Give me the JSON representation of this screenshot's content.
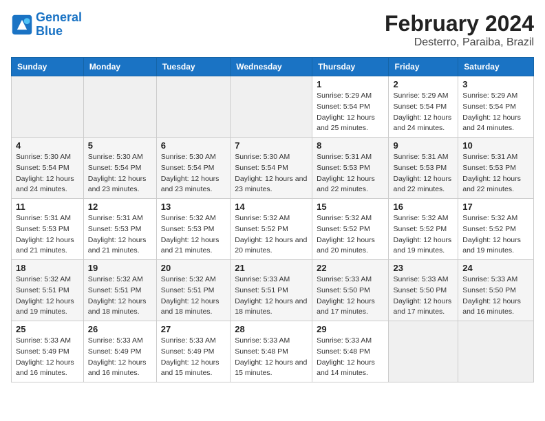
{
  "logo": {
    "line1": "General",
    "line2": "Blue"
  },
  "title": "February 2024",
  "subtitle": "Desterro, Paraiba, Brazil",
  "days_of_week": [
    "Sunday",
    "Monday",
    "Tuesday",
    "Wednesday",
    "Thursday",
    "Friday",
    "Saturday"
  ],
  "weeks": [
    [
      {
        "day": "",
        "sunrise": "",
        "sunset": "",
        "daylight": "",
        "empty": true
      },
      {
        "day": "",
        "sunrise": "",
        "sunset": "",
        "daylight": "",
        "empty": true
      },
      {
        "day": "",
        "sunrise": "",
        "sunset": "",
        "daylight": "",
        "empty": true
      },
      {
        "day": "",
        "sunrise": "",
        "sunset": "",
        "daylight": "",
        "empty": true
      },
      {
        "day": "1",
        "sunrise": "5:29 AM",
        "sunset": "5:54 PM",
        "daylight": "12 hours and 25 minutes.",
        "empty": false
      },
      {
        "day": "2",
        "sunrise": "5:29 AM",
        "sunset": "5:54 PM",
        "daylight": "12 hours and 24 minutes.",
        "empty": false
      },
      {
        "day": "3",
        "sunrise": "5:29 AM",
        "sunset": "5:54 PM",
        "daylight": "12 hours and 24 minutes.",
        "empty": false
      }
    ],
    [
      {
        "day": "4",
        "sunrise": "5:30 AM",
        "sunset": "5:54 PM",
        "daylight": "12 hours and 24 minutes.",
        "empty": false
      },
      {
        "day": "5",
        "sunrise": "5:30 AM",
        "sunset": "5:54 PM",
        "daylight": "12 hours and 23 minutes.",
        "empty": false
      },
      {
        "day": "6",
        "sunrise": "5:30 AM",
        "sunset": "5:54 PM",
        "daylight": "12 hours and 23 minutes.",
        "empty": false
      },
      {
        "day": "7",
        "sunrise": "5:30 AM",
        "sunset": "5:54 PM",
        "daylight": "12 hours and 23 minutes.",
        "empty": false
      },
      {
        "day": "8",
        "sunrise": "5:31 AM",
        "sunset": "5:53 PM",
        "daylight": "12 hours and 22 minutes.",
        "empty": false
      },
      {
        "day": "9",
        "sunrise": "5:31 AM",
        "sunset": "5:53 PM",
        "daylight": "12 hours and 22 minutes.",
        "empty": false
      },
      {
        "day": "10",
        "sunrise": "5:31 AM",
        "sunset": "5:53 PM",
        "daylight": "12 hours and 22 minutes.",
        "empty": false
      }
    ],
    [
      {
        "day": "11",
        "sunrise": "5:31 AM",
        "sunset": "5:53 PM",
        "daylight": "12 hours and 21 minutes.",
        "empty": false
      },
      {
        "day": "12",
        "sunrise": "5:31 AM",
        "sunset": "5:53 PM",
        "daylight": "12 hours and 21 minutes.",
        "empty": false
      },
      {
        "day": "13",
        "sunrise": "5:32 AM",
        "sunset": "5:53 PM",
        "daylight": "12 hours and 21 minutes.",
        "empty": false
      },
      {
        "day": "14",
        "sunrise": "5:32 AM",
        "sunset": "5:52 PM",
        "daylight": "12 hours and 20 minutes.",
        "empty": false
      },
      {
        "day": "15",
        "sunrise": "5:32 AM",
        "sunset": "5:52 PM",
        "daylight": "12 hours and 20 minutes.",
        "empty": false
      },
      {
        "day": "16",
        "sunrise": "5:32 AM",
        "sunset": "5:52 PM",
        "daylight": "12 hours and 19 minutes.",
        "empty": false
      },
      {
        "day": "17",
        "sunrise": "5:32 AM",
        "sunset": "5:52 PM",
        "daylight": "12 hours and 19 minutes.",
        "empty": false
      }
    ],
    [
      {
        "day": "18",
        "sunrise": "5:32 AM",
        "sunset": "5:51 PM",
        "daylight": "12 hours and 19 minutes.",
        "empty": false
      },
      {
        "day": "19",
        "sunrise": "5:32 AM",
        "sunset": "5:51 PM",
        "daylight": "12 hours and 18 minutes.",
        "empty": false
      },
      {
        "day": "20",
        "sunrise": "5:32 AM",
        "sunset": "5:51 PM",
        "daylight": "12 hours and 18 minutes.",
        "empty": false
      },
      {
        "day": "21",
        "sunrise": "5:33 AM",
        "sunset": "5:51 PM",
        "daylight": "12 hours and 18 minutes.",
        "empty": false
      },
      {
        "day": "22",
        "sunrise": "5:33 AM",
        "sunset": "5:50 PM",
        "daylight": "12 hours and 17 minutes.",
        "empty": false
      },
      {
        "day": "23",
        "sunrise": "5:33 AM",
        "sunset": "5:50 PM",
        "daylight": "12 hours and 17 minutes.",
        "empty": false
      },
      {
        "day": "24",
        "sunrise": "5:33 AM",
        "sunset": "5:50 PM",
        "daylight": "12 hours and 16 minutes.",
        "empty": false
      }
    ],
    [
      {
        "day": "25",
        "sunrise": "5:33 AM",
        "sunset": "5:49 PM",
        "daylight": "12 hours and 16 minutes.",
        "empty": false
      },
      {
        "day": "26",
        "sunrise": "5:33 AM",
        "sunset": "5:49 PM",
        "daylight": "12 hours and 16 minutes.",
        "empty": false
      },
      {
        "day": "27",
        "sunrise": "5:33 AM",
        "sunset": "5:49 PM",
        "daylight": "12 hours and 15 minutes.",
        "empty": false
      },
      {
        "day": "28",
        "sunrise": "5:33 AM",
        "sunset": "5:48 PM",
        "daylight": "12 hours and 15 minutes.",
        "empty": false
      },
      {
        "day": "29",
        "sunrise": "5:33 AM",
        "sunset": "5:48 PM",
        "daylight": "12 hours and 14 minutes.",
        "empty": false
      },
      {
        "day": "",
        "sunrise": "",
        "sunset": "",
        "daylight": "",
        "empty": true
      },
      {
        "day": "",
        "sunrise": "",
        "sunset": "",
        "daylight": "",
        "empty": true
      }
    ]
  ]
}
